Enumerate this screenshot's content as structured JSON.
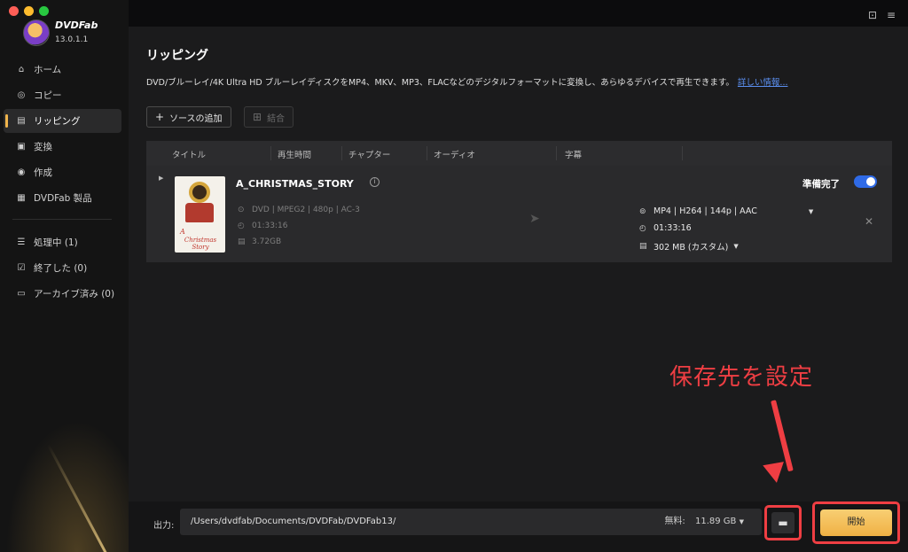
{
  "window": {
    "controls": [
      "close",
      "minimize",
      "zoom"
    ]
  },
  "app": {
    "brand": "DVDFab",
    "version": "13.0.1.1"
  },
  "sidebar": {
    "items": [
      {
        "label": "ホーム",
        "icon": "home-icon"
      },
      {
        "label": "コピー",
        "icon": "copy-icon"
      },
      {
        "label": "リッピング",
        "icon": "ripper-icon",
        "active": true
      },
      {
        "label": "変換",
        "icon": "converter-icon"
      },
      {
        "label": "作成",
        "icon": "creator-icon"
      },
      {
        "label": "DVDFab 製品",
        "icon": "products-icon"
      }
    ],
    "queue": [
      {
        "label": "処理中 (1)",
        "icon": "processing-icon"
      },
      {
        "label": "終了した (0)",
        "icon": "finished-icon"
      },
      {
        "label": "アーカイブ済み (0)",
        "icon": "archive-icon"
      }
    ]
  },
  "topbar": {
    "icons": [
      "skin-icon",
      "menu-icon",
      "minimize-icon",
      "close-icon"
    ]
  },
  "main": {
    "title": "リッピング",
    "description": "DVD/ブルーレイ/4K Ultra HD ブルーレイディスクをMP4、MKV、MP3、FLACなどのデジタルフォーマットに変換し、あらゆるデバイスで再生できます。",
    "more_link": "詳しい情報...",
    "add_source": "ソースの追加",
    "merge": "結合",
    "columns": [
      "タイトル",
      "再生時間",
      "チャプター",
      "オーディオ",
      "字幕"
    ]
  },
  "task": {
    "title": "A_CHRISTMAS_STORY",
    "thumb_text_1": "A",
    "thumb_text_2": "Christmas Story",
    "source_format": "DVD | MPEG2 | 480p | AC-3",
    "source_duration": "01:33:16",
    "source_size": "3.72GB",
    "status": "準備完了",
    "enabled": true,
    "output_format": "MP4 | H264 | 144p | AAC",
    "output_duration": "01:33:16",
    "output_size": "302 MB (カスタム)"
  },
  "annotation": {
    "text": "保存先を設定",
    "color": "#ef3e43"
  },
  "bottom": {
    "output_label": "出力:",
    "path": "/Users/dvdfab/Documents/DVDFab/DVDFab13/",
    "free_label": "無料:",
    "free_value": "11.89 GB",
    "start": "開始"
  },
  "colors": {
    "accent": "#2f6ae6",
    "start": "#f0b144",
    "highlight": "#ef3e43"
  }
}
